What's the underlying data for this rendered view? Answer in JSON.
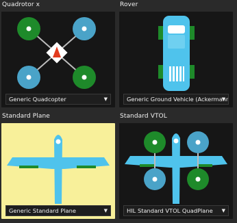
{
  "frames": [
    {
      "title": "Quadrotor x",
      "selection": "Generic Quadcopter",
      "selected": false
    },
    {
      "title": "Rover",
      "selection": "Generic Ground Vehicle (Ackermann)",
      "selected": false
    },
    {
      "title": "Standard Plane",
      "selection": "Generic Standard Plane",
      "selected": true
    },
    {
      "title": "Standard VTOL",
      "selection": "HIL Standard VTOL QuadPlane",
      "selected": false
    }
  ],
  "dropdown_arrow": "▼",
  "colors": {
    "background": "#2a2a2a",
    "card": "#161616",
    "card_selected": "#f8f09a",
    "body_blue": "#4fc3ec",
    "motor_green": "#1e8a2a",
    "motor_blue": "#4aa3c8",
    "heading_red": "#e23b1e"
  }
}
